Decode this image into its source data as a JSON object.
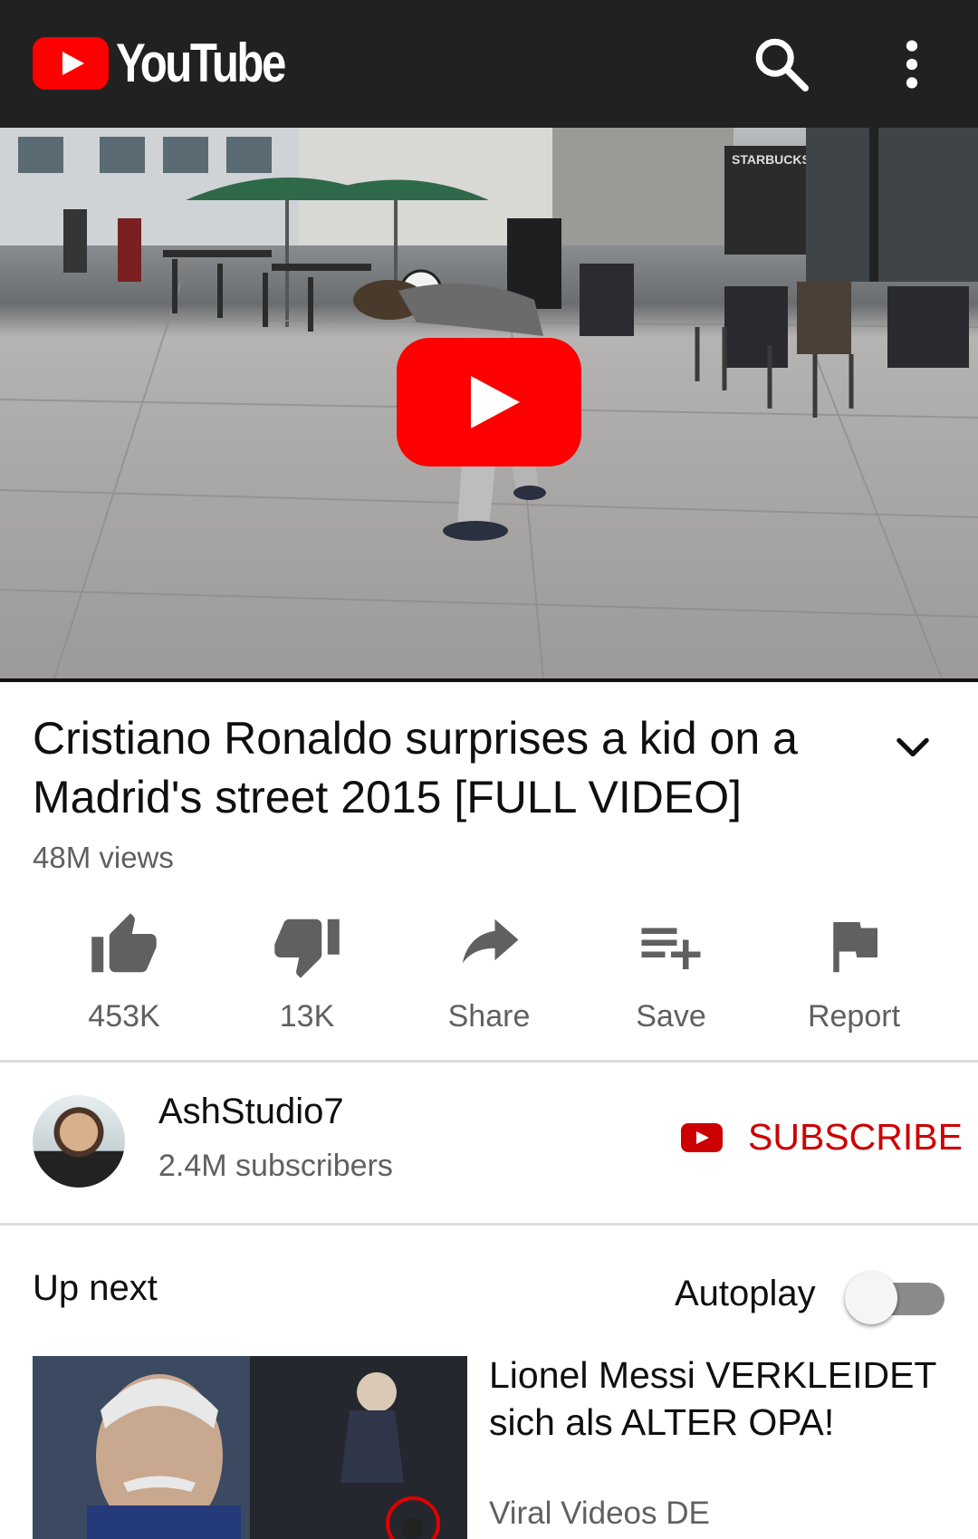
{
  "header": {
    "logo_text": "YouTube",
    "icons": [
      "youtube-logo-icon",
      "search-icon",
      "more-vert-icon"
    ]
  },
  "player": {
    "play_icon": "play-icon",
    "scene_sign": "STARBUCKS COFFEE"
  },
  "video": {
    "title": "Cristiano Ronaldo surprises a kid on a Madrid's street 2015 [FULL VIDEO]",
    "views": "48M views"
  },
  "actions": [
    {
      "icon": "thumb-up-icon",
      "label": "453K"
    },
    {
      "icon": "thumb-down-icon",
      "label": "13K"
    },
    {
      "icon": "share-icon",
      "label": "Share"
    },
    {
      "icon": "playlist-add-icon",
      "label": "Save"
    },
    {
      "icon": "flag-icon",
      "label": "Report"
    }
  ],
  "channel": {
    "name": "AshStudio7",
    "subscribers": "2.4M subscribers",
    "subscribe_label": "SUBSCRIBE"
  },
  "upnext": {
    "heading": "Up next",
    "autoplay_label": "Autoplay",
    "autoplay_on": false,
    "items": [
      {
        "title": "Lionel Messi VERKLEIDET sich als ALTER OPA!",
        "channel": "Viral Videos DE"
      }
    ]
  },
  "colors": {
    "appbar": "#212121",
    "brand_red": "#ff0000",
    "subscribe_red": "#cc0000",
    "secondary_text": "#606060"
  }
}
